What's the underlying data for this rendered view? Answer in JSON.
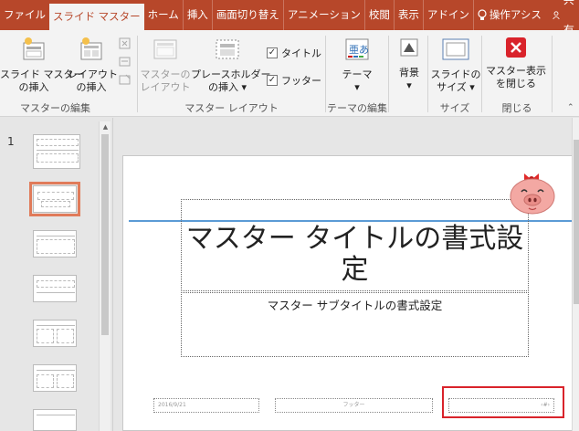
{
  "tabs": [
    {
      "label": "ファイル",
      "active": false
    },
    {
      "label": "スライド マスター",
      "active": true
    },
    {
      "label": "ホーム",
      "active": false
    },
    {
      "label": "挿入",
      "active": false
    },
    {
      "label": "画面切り替え",
      "active": false
    },
    {
      "label": "アニメーション",
      "active": false
    },
    {
      "label": "校閲",
      "active": false
    },
    {
      "label": "表示",
      "active": false
    },
    {
      "label": "アドイン",
      "active": false
    }
  ],
  "tell_me": "操作アシス",
  "share": "共有",
  "ribbon": {
    "master_edit": {
      "label": "マスターの編集",
      "insert_master_line1": "スライド マスター",
      "insert_master_line2": "の挿入",
      "insert_layout_line1": "レイアウト",
      "insert_layout_line2": "の挿入"
    },
    "master_layout": {
      "label": "マスター レイアウト",
      "master_layout_line1": "マスターの",
      "master_layout_line2": "レイアウト",
      "placeholder_line1": "プレースホルダー",
      "placeholder_line2": "の挿入",
      "title_check": "タイトル",
      "footer_check": "フッター",
      "title_checked": true,
      "footer_checked": true
    },
    "theme_edit": {
      "label": "テーマの編集",
      "theme": "テーマ",
      "theme_icon_text": "亜あ"
    },
    "background": {
      "label": "背景"
    },
    "size": {
      "label": "サイズ",
      "slide_size_line1": "スライドの",
      "slide_size_line2": "サイズ"
    },
    "close": {
      "label": "閉じる",
      "close_line1": "マスター表示",
      "close_line2": "を閉じる",
      "close_color": "#d9232b"
    }
  },
  "thumbnail_number": "1",
  "slide": {
    "title": "マスター タイトルの書式設定",
    "subtitle": "マスター サブタイトルの書式設定",
    "footer_date": "2016/9/21",
    "footer_text": "フッター",
    "footer_num": "‹#›"
  },
  "colors": {
    "accent": "#b7472a",
    "guide_line": "#5b9bd5",
    "highlight": "#d9232b",
    "thumb_selected": "#e07b5a"
  }
}
